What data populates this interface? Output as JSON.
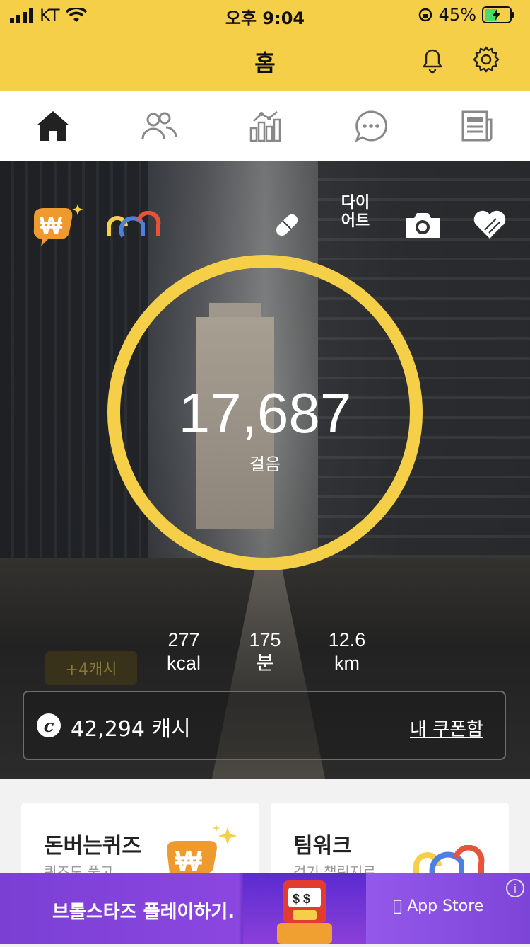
{
  "status_bar": {
    "carrier": "KT",
    "time": "오후 9:04",
    "battery": "45%"
  },
  "header": {
    "title": "홈",
    "accent_color": "#f5cf47"
  },
  "tabs": [
    {
      "name": "home",
      "icon": "home-icon"
    },
    {
      "name": "friends",
      "icon": "people-icon"
    },
    {
      "name": "stats",
      "icon": "chart-icon"
    },
    {
      "name": "chat",
      "icon": "chat-icon"
    },
    {
      "name": "news",
      "icon": "news-icon"
    }
  ],
  "hero": {
    "diet_label_1": "다이",
    "diet_label_2": "어트",
    "steps": "17,687",
    "steps_label": "걸음",
    "calories": "277",
    "calories_unit": "kcal",
    "minutes": "175",
    "minutes_unit": "분",
    "distance": "12.6",
    "distance_unit": "km",
    "bonus": "+4캐시",
    "cash_amount": "42,294 캐시",
    "coupon_link": "내 쿠폰함"
  },
  "cards": [
    {
      "title": "돈버는퀴즈",
      "subtitle": "퀴즈도 풀고"
    },
    {
      "title": "팀워크",
      "subtitle": "걷기 챌린지로"
    }
  ],
  "ad": {
    "text": "브롤스타즈 플레이하기.",
    "store": "App Store",
    "info": "i"
  }
}
